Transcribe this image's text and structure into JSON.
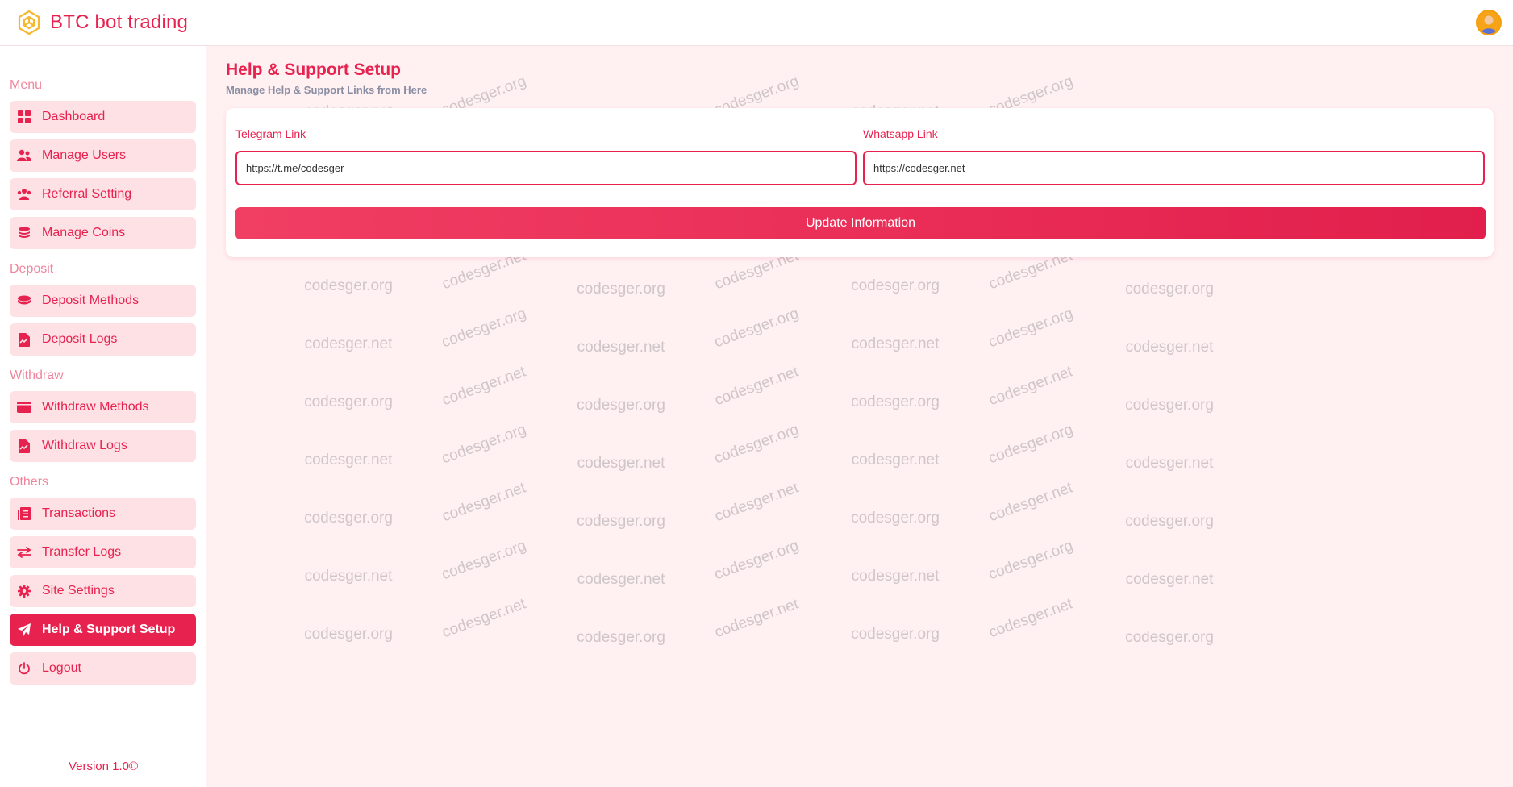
{
  "app": {
    "title": "BTC bot trading"
  },
  "sidebar": {
    "sections": [
      {
        "label": "Menu",
        "items": [
          "Dashboard",
          "Manage Users",
          "Referral Setting",
          "Manage Coins"
        ]
      },
      {
        "label": "Deposit",
        "items": [
          "Deposit Methods",
          "Deposit Logs"
        ]
      },
      {
        "label": "Withdraw",
        "items": [
          "Withdraw Methods",
          "Withdraw Logs"
        ]
      },
      {
        "label": "Others",
        "items": [
          "Transactions",
          "Transfer Logs",
          "Site Settings",
          "Help & Support Setup",
          "Logout"
        ]
      }
    ],
    "active_item": "Help & Support Setup",
    "version": "Version 1.0©"
  },
  "page": {
    "title": "Help & Support Setup",
    "subtitle": "Manage Help & Support Links from Here"
  },
  "form": {
    "telegram": {
      "label": "Telegram Link",
      "value": "https://t.me/codesger"
    },
    "whatsapp": {
      "label": "Whatsapp Link",
      "value": "https://codesger.net"
    },
    "submit_label": "Update Information"
  },
  "watermark": {
    "texts": [
      "codesger.net",
      "codesger.org"
    ]
  },
  "colors": {
    "accent": "#e8224f",
    "nav_bg": "#fde1e5",
    "page_bg": "#fff0f1",
    "brand_icon": "#f5b82e"
  }
}
